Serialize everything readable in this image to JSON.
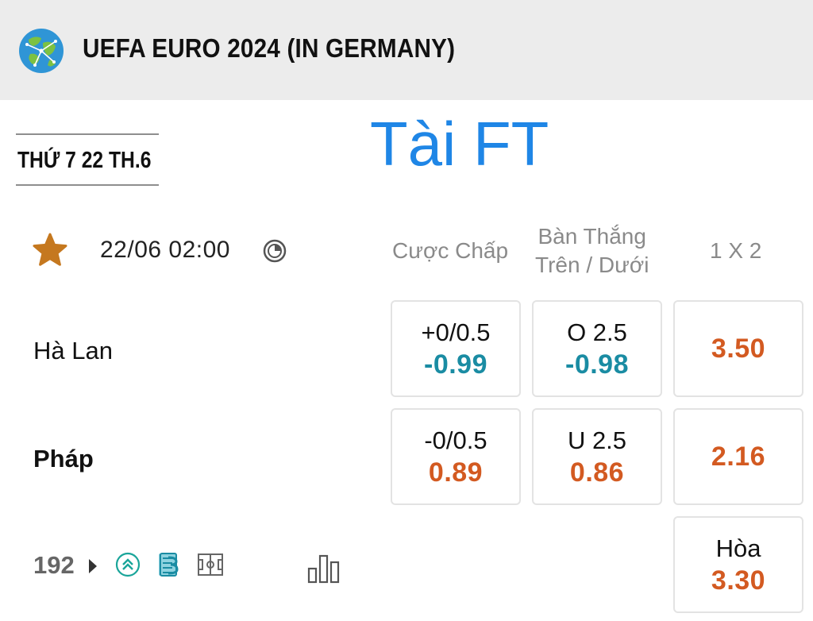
{
  "header": {
    "league_title": "UEFA EURO 2024 (IN GERMANY)"
  },
  "date_label": "THỨ 7 22 TH.6",
  "overlay_label": "Tài FT",
  "match": {
    "kickoff": "22/06 02:00",
    "columns": {
      "handicap": "Cược Chấp",
      "over_under_line1": "Bàn Thắng",
      "over_under_line2": "Trên / Dưới",
      "one_x_two": "1 X 2"
    },
    "home": {
      "name": "Hà Lan",
      "handicap_line": "+0/0.5",
      "handicap_price": "-0.99",
      "ou_line": "O 2.5",
      "ou_price": "-0.98",
      "win_price": "3.50"
    },
    "away": {
      "name": "Pháp",
      "handicap_line": "-0/0.5",
      "handicap_price": "0.89",
      "ou_line": "U 2.5",
      "ou_price": "0.86",
      "win_price": "2.16"
    },
    "draw": {
      "label": "Hòa",
      "price": "3.30"
    },
    "more_markets_count": "192"
  },
  "colors": {
    "accent_blue": "#1f86e6",
    "negative_teal": "#1a8ca3",
    "positive_orange": "#d35a21",
    "star": "#c5781f"
  },
  "icons": [
    "globe-icon",
    "star-icon",
    "clock-icon",
    "chevron-right-icon",
    "double-up-icon",
    "stats-book-icon",
    "pitch-icon",
    "bar-chart-icon"
  ]
}
